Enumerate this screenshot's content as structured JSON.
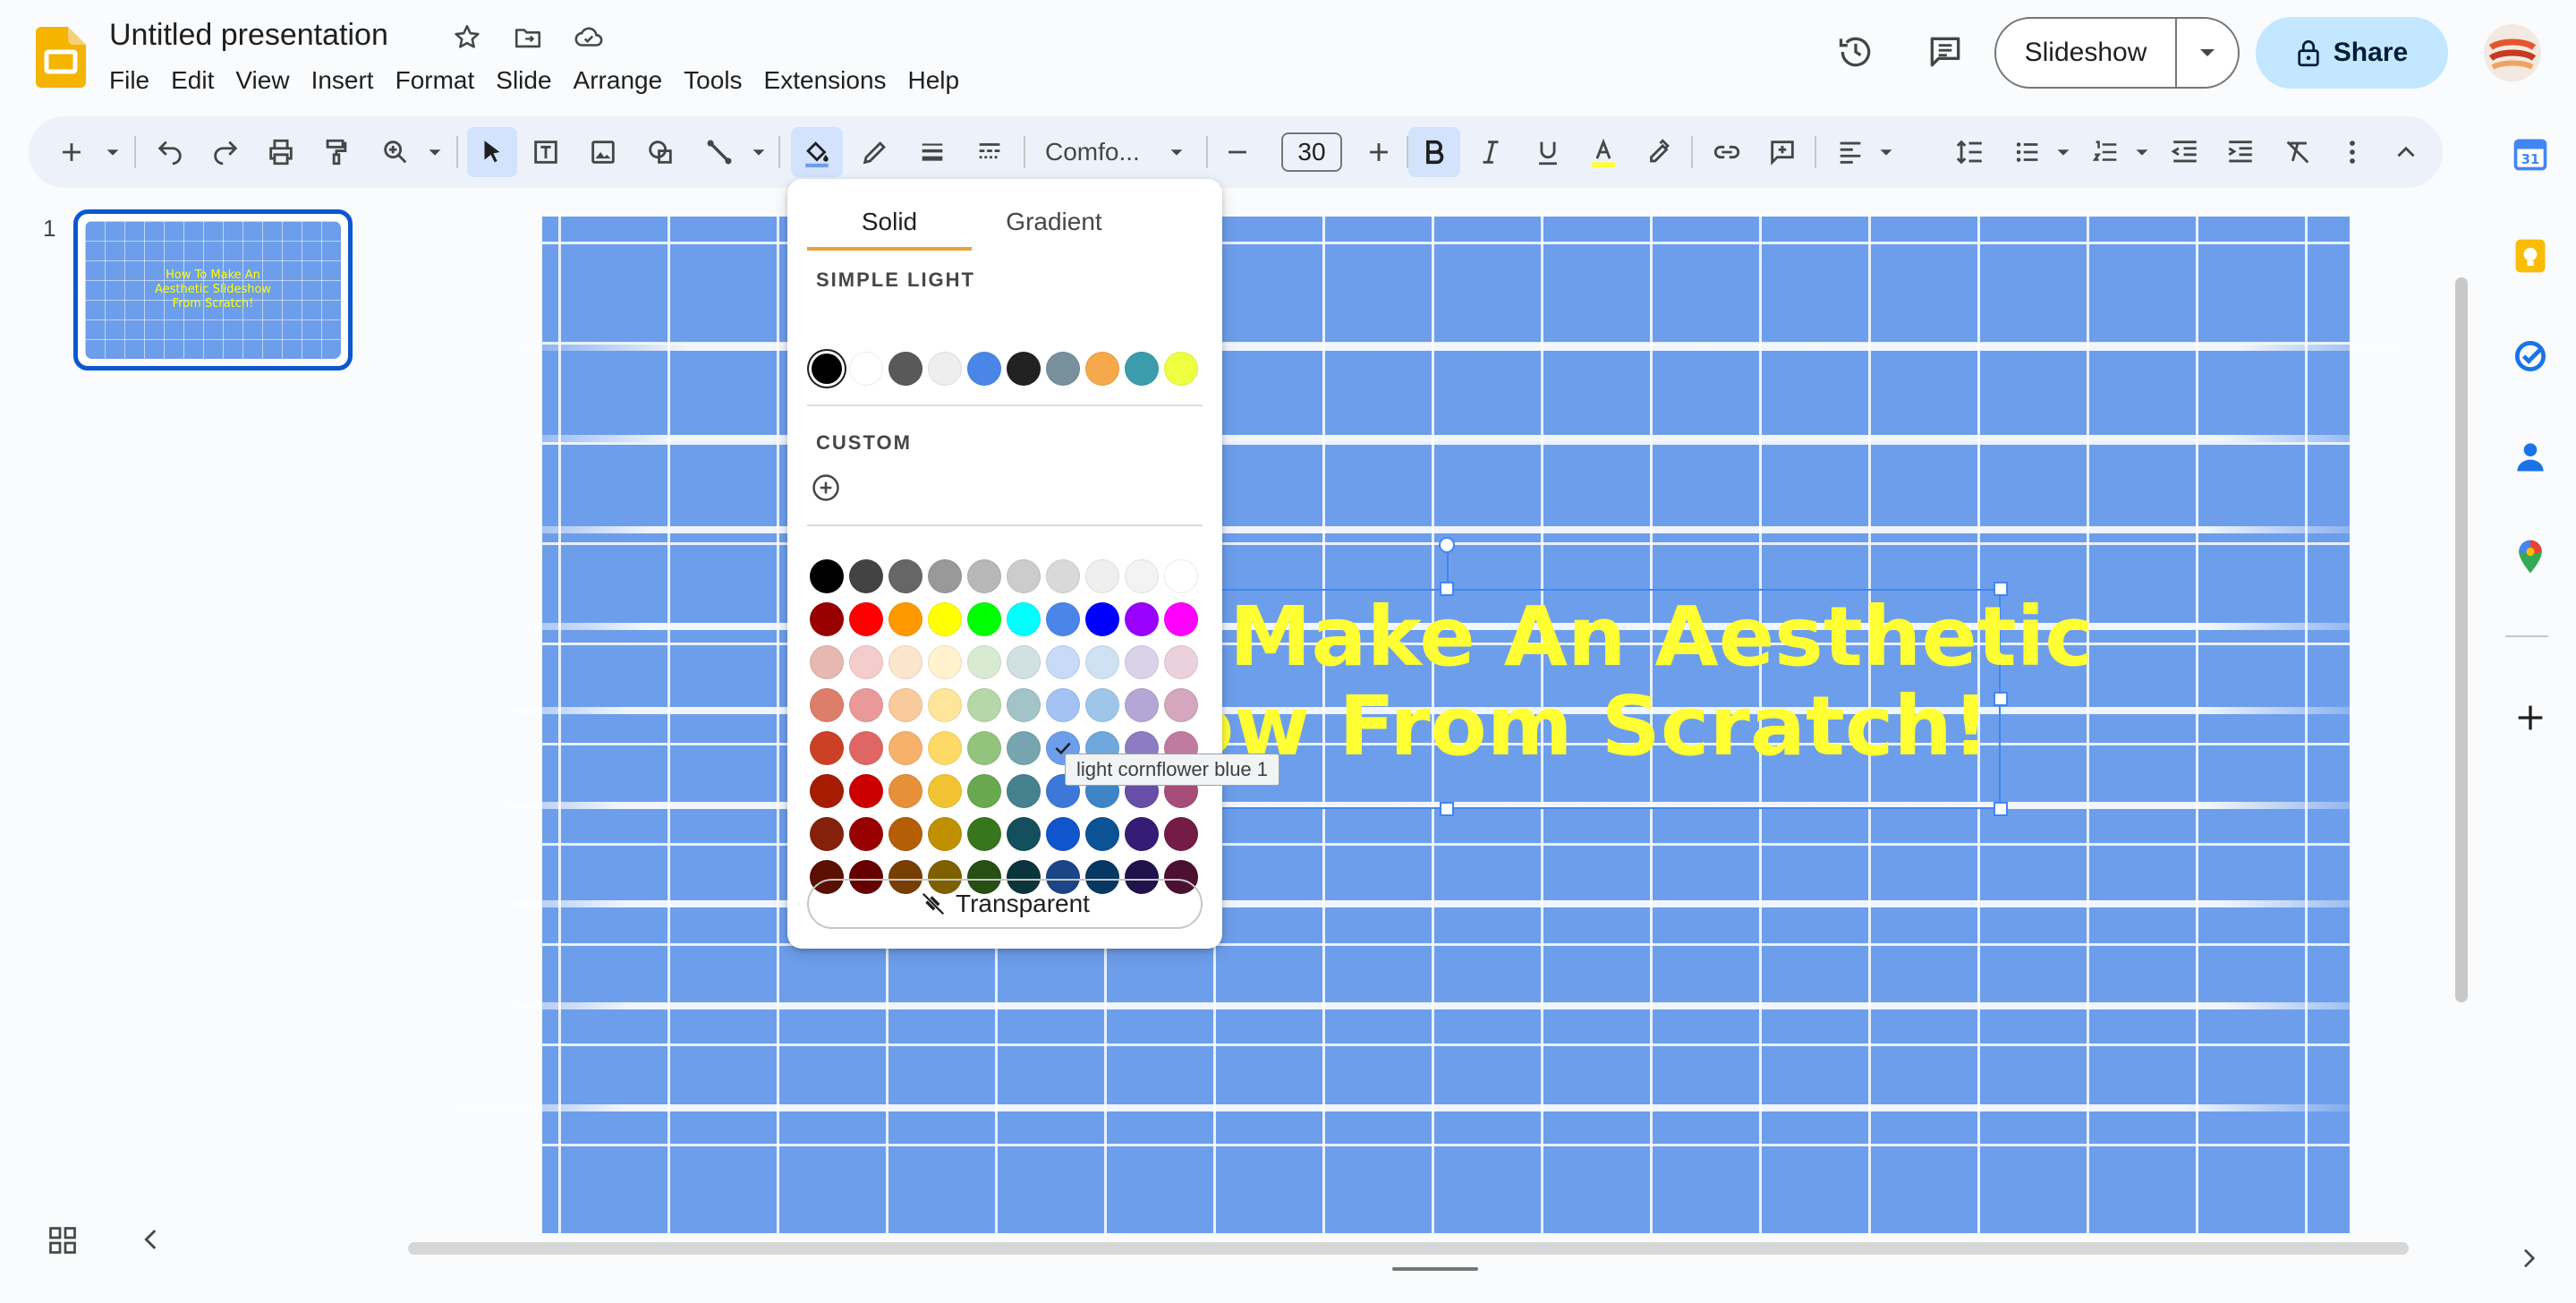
{
  "app": {
    "title": "Untitled presentation"
  },
  "menu": [
    "File",
    "Edit",
    "View",
    "Insert",
    "Format",
    "Slide",
    "Arrange",
    "Tools",
    "Extensions",
    "Help"
  ],
  "header": {
    "slideshow_label": "Slideshow",
    "share_label": "Share"
  },
  "toolbar": {
    "font_name": "Comfo...",
    "font_size": "30"
  },
  "filmstrip": {
    "slide_number": "1",
    "thumb_text": "How To Make An Aesthetic Slideshow From Scratch!"
  },
  "slide": {
    "title_line1": "Make An Aesthetic",
    "title_line2": "ow From Scratch!"
  },
  "color_picker": {
    "tabs": [
      "Solid",
      "Gradient"
    ],
    "theme_heading": "SIMPLE LIGHT",
    "custom_heading": "CUSTOM",
    "transparent_label": "Transparent",
    "tooltip": "light cornflower blue 1",
    "selected_color": "#6d9eeb",
    "theme_colors": [
      "#000000",
      "#ffffff",
      "#595959",
      "#eeeeee",
      "#4a86e8",
      "#212121",
      "#78909c",
      "#f6a94a",
      "#3b9cac",
      "#eeff41"
    ],
    "palette": [
      [
        "#000000",
        "#434343",
        "#666666",
        "#999999",
        "#b7b7b7",
        "#cccccc",
        "#d9d9d9",
        "#efefef",
        "#f3f3f3",
        "#ffffff"
      ],
      [
        "#980000",
        "#ff0000",
        "#ff9900",
        "#ffff00",
        "#00ff00",
        "#00ffff",
        "#4a86e8",
        "#0000ff",
        "#9900ff",
        "#ff00ff"
      ],
      [
        "#e6b8af",
        "#f4cccc",
        "#fce5cd",
        "#fff2cc",
        "#d9ead3",
        "#d0e0e3",
        "#c9daf8",
        "#cfe2f3",
        "#d9d2e9",
        "#ead1dc"
      ],
      [
        "#dd7e6b",
        "#ea9999",
        "#f9cb9c",
        "#ffe599",
        "#b6d7a8",
        "#a2c4c9",
        "#a4c2f4",
        "#9fc5e8",
        "#b4a7d6",
        "#d5a6bd"
      ],
      [
        "#cc4125",
        "#e06666",
        "#f6b26b",
        "#ffd966",
        "#93c47d",
        "#76a5af",
        "#6d9eeb",
        "#6fa8dc",
        "#8e7cc3",
        "#c27ba0"
      ],
      [
        "#a61c00",
        "#cc0000",
        "#e69138",
        "#f1c232",
        "#6aa84f",
        "#45818e",
        "#3c78d8",
        "#3d85c6",
        "#674ea7",
        "#a64d79"
      ],
      [
        "#85200c",
        "#990000",
        "#b45f06",
        "#bf9000",
        "#38761d",
        "#134f5c",
        "#1155cc",
        "#0b5394",
        "#351c75",
        "#741b47"
      ],
      [
        "#5b0f00",
        "#660000",
        "#783f04",
        "#7f6000",
        "#274e13",
        "#0c343d",
        "#1c4587",
        "#073763",
        "#20124d",
        "#4c1130"
      ]
    ]
  },
  "colors": {
    "accent": "#0b57d0",
    "share_bg": "#c2e7ff",
    "slide_bg": "#6d9eeb",
    "title_text": "#ffff33"
  }
}
